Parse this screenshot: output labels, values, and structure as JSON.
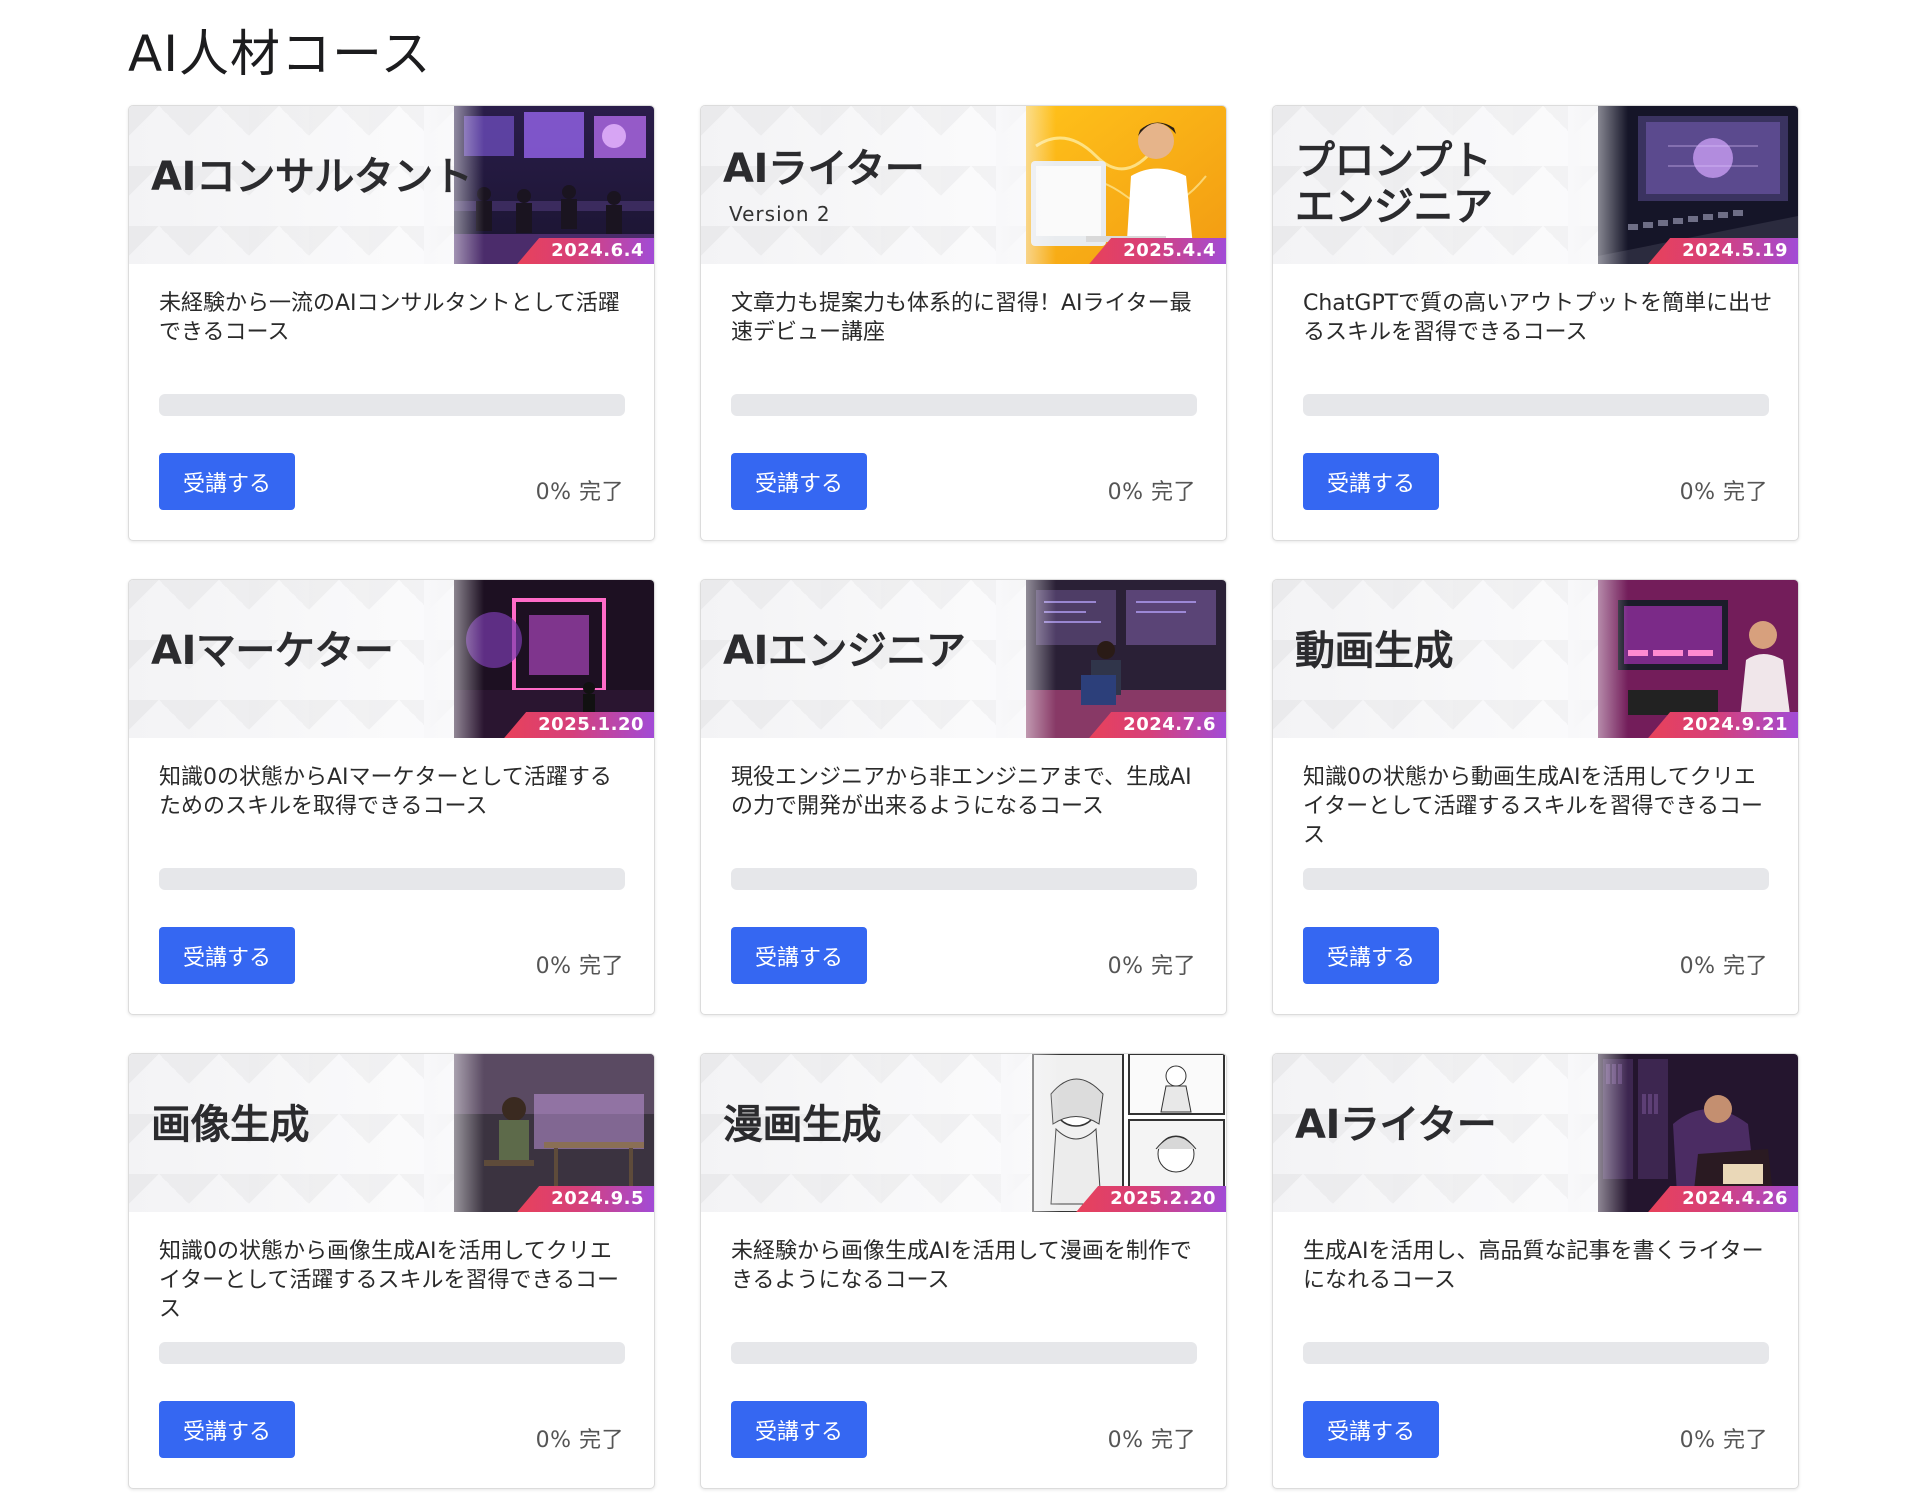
{
  "page": {
    "title": "AI人材コース"
  },
  "labels": {
    "enroll": "受講する",
    "complete_suffix": "完了"
  },
  "colors": {
    "accent": "#3567f2",
    "badge_start": "#e8415a",
    "badge_end": "#a24bd6",
    "progress_track": "#e6e7ea"
  },
  "courses": [
    {
      "banner_title": "AIコンサルタント",
      "banner_sub": "",
      "date": "2024.6.4",
      "description": "未経験から一流のAIコンサルタントとして活躍できるコース",
      "progress_percent": 0,
      "progress_text": "0%",
      "art": "consulting-room-scene"
    },
    {
      "banner_title": "AIライター",
      "banner_sub": "Version 2",
      "date": "2025.4.4",
      "description": "文章力も提案力も体系的に習得！AIライター最速デビュー講座",
      "progress_percent": 0,
      "progress_text": "0%",
      "art": "writer-at-desk-scene"
    },
    {
      "banner_title": "プロンプト\nエンジニア",
      "banner_sub": "",
      "date": "2024.5.19",
      "description": "ChatGPTで質の高いアウトプットを簡単に出せるスキルを習得できるコース",
      "progress_percent": 0,
      "progress_text": "0%",
      "art": "keyboard-monitor-scene"
    },
    {
      "banner_title": "AIマーケター",
      "banner_sub": "",
      "date": "2025.1.20",
      "description": "知識0の状態からAIマーケターとして活躍するためのスキルを取得できるコース",
      "progress_percent": 0,
      "progress_text": "0%",
      "art": "neon-room-scene"
    },
    {
      "banner_title": "AIエンジニア",
      "banner_sub": "",
      "date": "2024.7.6",
      "description": "現役エンジニアから非エンジニアまで、生成AIの力で開発が出来るようになるコース",
      "progress_percent": 0,
      "progress_text": "0%",
      "art": "engineer-office-scene"
    },
    {
      "banner_title": "動画生成",
      "banner_sub": "",
      "date": "2024.9.21",
      "description": "知識0の状態から動画生成AIを活用してクリエイターとして活躍するスキルを習得できるコース",
      "progress_percent": 0,
      "progress_text": "0%",
      "art": "video-editing-scene"
    },
    {
      "banner_title": "画像生成",
      "banner_sub": "",
      "date": "2024.9.5",
      "description": "知識0の状態から画像生成AIを活用してクリエイターとして活躍するスキルを習得できるコース",
      "progress_percent": 0,
      "progress_text": "0%",
      "art": "image-studio-scene"
    },
    {
      "banner_title": "漫画生成",
      "banner_sub": "",
      "date": "2025.2.20",
      "description": "未経験から画像生成AIを活用して漫画を制作できるようになるコース",
      "progress_percent": 0,
      "progress_text": "0%",
      "art": "manga-panels-scene"
    },
    {
      "banner_title": "AIライター",
      "banner_sub": "",
      "date": "2024.4.26",
      "description": "生成AIを活用し、高品質な記事を書くライターになれるコース",
      "progress_percent": 0,
      "progress_text": "0%",
      "art": "library-writer-scene"
    }
  ]
}
